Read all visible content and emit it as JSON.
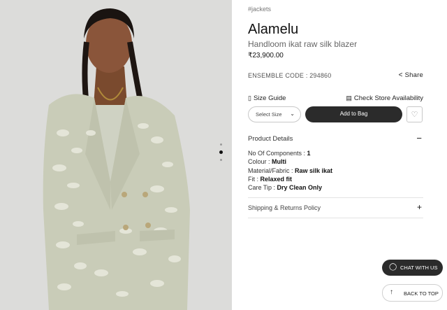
{
  "product": {
    "tag": "#jackets",
    "name": "Alamelu",
    "subtitle": "Handloom ikat raw silk blazer",
    "price": "₹23,900.00",
    "ensemble_code": "ENSEMBLE CODE : 294860"
  },
  "actions": {
    "share": "Share",
    "size_guide": "Size Guide",
    "check_store": "Check Store Availability",
    "select_size": "Select Size",
    "add_to_bag": "Add to Bag"
  },
  "details": {
    "heading": "Product Details",
    "items": [
      {
        "label": "No Of Components : ",
        "value": "1"
      },
      {
        "label": "Colour : ",
        "value": "Multi"
      },
      {
        "label": "Material/Fabric : ",
        "value": "Raw silk ikat"
      },
      {
        "label": "Fit : ",
        "value": "Relaxed fit"
      },
      {
        "label": "Care Tip : ",
        "value": "Dry Clean Only"
      }
    ]
  },
  "shipping": {
    "heading": "Shipping & Returns Policy"
  },
  "widgets": {
    "chat": "CHAT WITH US",
    "back_to_top": "BACK TO TOP"
  },
  "carousel": {
    "slides": 3,
    "active_index": 1
  }
}
